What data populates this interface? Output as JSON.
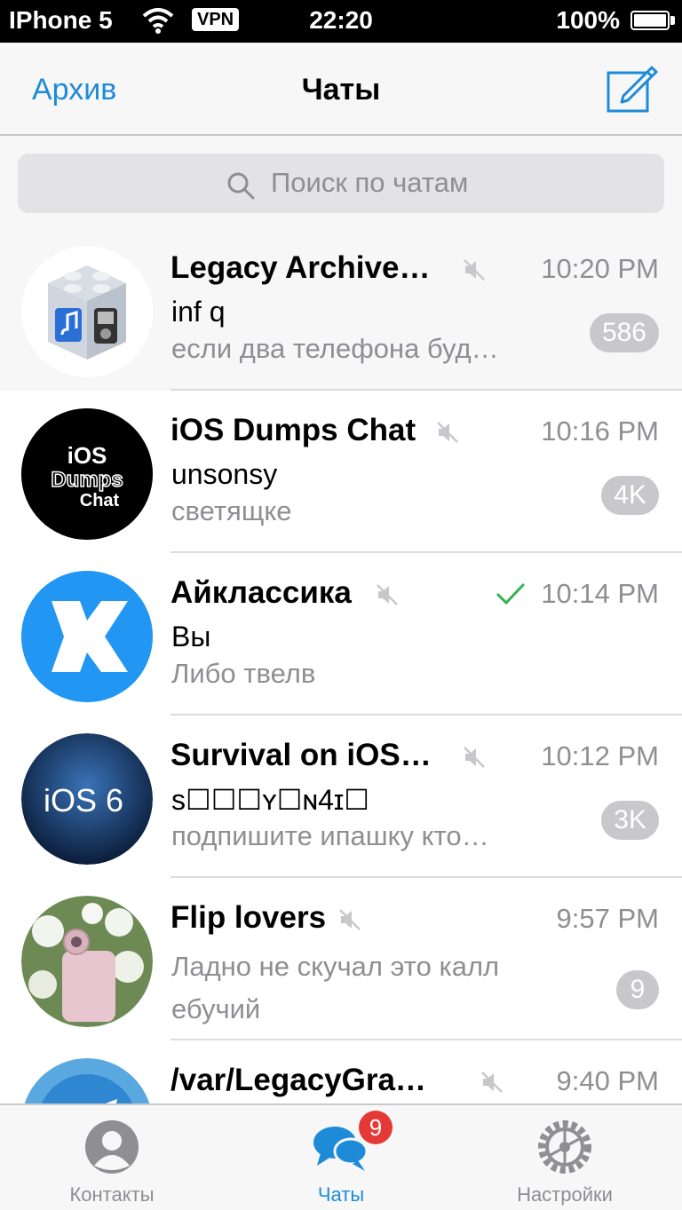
{
  "status_bar": {
    "carrier": "IPhone 5",
    "vpn": "VPN",
    "time": "22:20",
    "battery": "100%"
  },
  "nav": {
    "left": "Архив",
    "title": "Чаты",
    "compose_icon": "compose-icon"
  },
  "search": {
    "placeholder": "Поиск по чатам"
  },
  "chats": [
    {
      "name": "Legacy Archive…",
      "muted": true,
      "time": "10:20 PM",
      "sender": "inf q",
      "preview": "если два телефона буд…",
      "badge": "586",
      "pinned": true
    },
    {
      "name": "iOS Dumps Chat",
      "muted": true,
      "time": "10:16 PM",
      "sender": "unsonsy",
      "preview": "светящке",
      "badge": "4K",
      "avatar_text": [
        "iOS",
        "Dumps",
        "Chat"
      ]
    },
    {
      "name": "Айклассика",
      "muted": true,
      "time": "10:14 PM",
      "sender": "Вы",
      "preview": "Либо твелв",
      "read": true
    },
    {
      "name": "Survival on iOS…",
      "muted": true,
      "time": "10:12 PM",
      "sender": "s☐☐☐ʏ☐ɴ4ɪ☐",
      "preview": "подпишите ипашку кто…",
      "badge": "3K",
      "avatar_text": "iOS 6"
    },
    {
      "name": "Flip lovers",
      "muted": true,
      "time": "9:57 PM",
      "preview": "Ладно не скучал это калл ебучий",
      "badge": "9"
    },
    {
      "name": "/var/LegacyGra…",
      "muted": true,
      "time": "9:40 PM"
    }
  ],
  "tabs": [
    {
      "label": "Контакты",
      "icon": "person-icon"
    },
    {
      "label": "Чаты",
      "icon": "chat-bubbles-icon",
      "badge": "9",
      "active": true
    },
    {
      "label": "Настройки",
      "icon": "gear-icon"
    }
  ],
  "colors": {
    "accent": "#1e8bd8",
    "badge_muted": "#c7c7cc",
    "badge_alert": "#e53935",
    "read_check": "#2fb34f"
  }
}
